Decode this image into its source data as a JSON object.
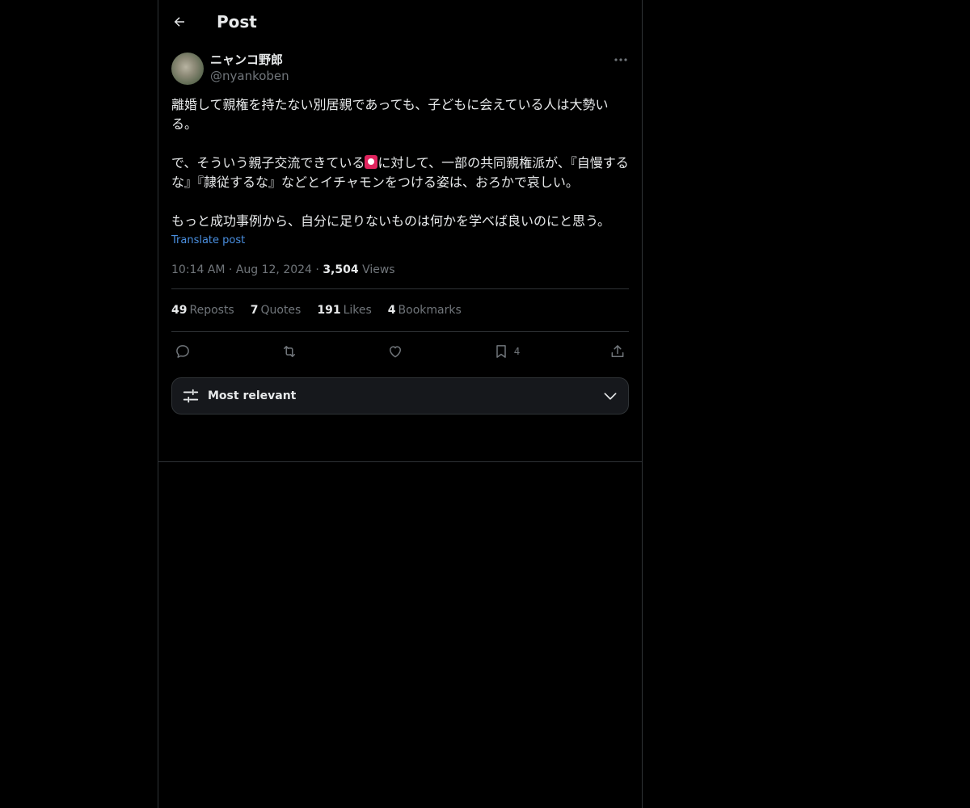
{
  "header": {
    "title": "Post"
  },
  "author": {
    "display_name": "ニャンコ野郎",
    "handle": "@nyankoben"
  },
  "post": {
    "paragraph_1": "離婚して親権を持たない別居親であっても、子どもに会えている人は大勢いる。",
    "paragraph_2_before_emoji": "で、そういう親子交流できている",
    "paragraph_2_after_emoji": "に対して、一部の共同親権派が、『自慢するな』『隷従するな』などとイチャモンをつける姿は、おろかで哀しい。",
    "paragraph_3": "もっと成功事例から、自分に足りないものは何かを学べば良いのにと思う。",
    "translate_label": "Translate post"
  },
  "meta": {
    "time": "10:14 AM",
    "date": "Aug 12, 2024",
    "views_count": "3,504",
    "views_label": "Views",
    "separator": "·"
  },
  "stats": {
    "reposts_count": "49",
    "reposts_label": "Reposts",
    "quotes_count": "7",
    "quotes_label": "Quotes",
    "likes_count": "191",
    "likes_label": "Likes",
    "bookmarks_count": "4",
    "bookmarks_label": "Bookmarks"
  },
  "actions": {
    "bookmark_count": "4"
  },
  "sort": {
    "label": "Most relevant"
  },
  "icons": {
    "back": "arrow-left-icon",
    "more": "more-horizontal-icon",
    "reply": "reply-icon",
    "repost": "repost-icon",
    "like": "heart-icon",
    "bookmark": "bookmark-icon",
    "share": "share-icon",
    "sort": "sliders-icon",
    "chevron": "chevron-down-icon"
  },
  "colors": {
    "background": "#000000",
    "text_primary": "#e7e9ea",
    "text_secondary": "#71767b",
    "link": "#4a8fe0",
    "border": "#2f3336",
    "sort_bar_bg": "#16181c"
  }
}
